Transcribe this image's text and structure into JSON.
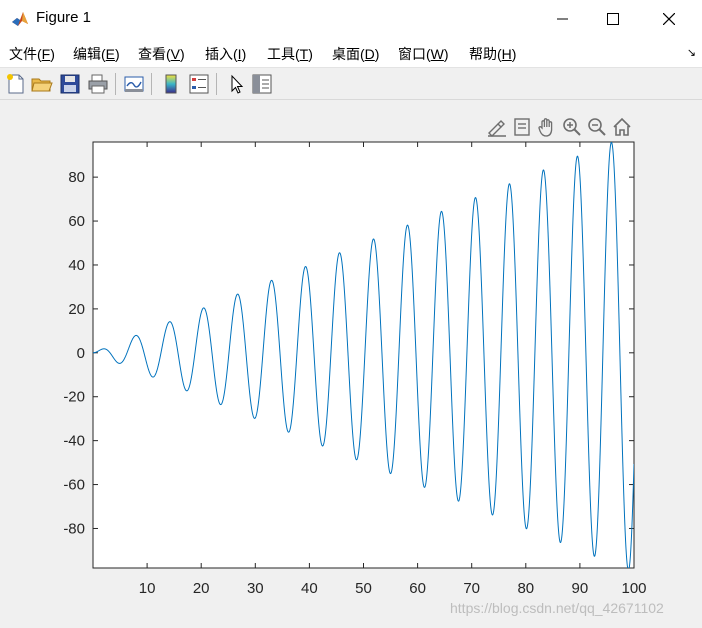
{
  "window": {
    "title": "Figure 1"
  },
  "menu": {
    "items": [
      {
        "label": "文件(",
        "key": "F",
        "tail": ")"
      },
      {
        "label": "编辑(",
        "key": "E",
        "tail": ")"
      },
      {
        "label": "查看(",
        "key": "V",
        "tail": ")"
      },
      {
        "label": "插入(",
        "key": "I",
        "tail": ")"
      },
      {
        "label": "工具(",
        "key": "T",
        "tail": ")"
      },
      {
        "label": "桌面(",
        "key": "D",
        "tail": ")"
      },
      {
        "label": "窗口(",
        "key": "W",
        "tail": ")"
      },
      {
        "label": "帮助(",
        "key": "H",
        "tail": ")"
      }
    ],
    "overflow_glyph": "↘"
  },
  "watermark": "https://blog.csdn.net/qq_42671102",
  "colors": {
    "line": "#0072bd",
    "axes_bg": "#ffffff",
    "figure_bg": "#f0f0f0"
  },
  "chart_data": {
    "type": "line",
    "title": "",
    "xlabel": "",
    "ylabel": "",
    "xlim": [
      0,
      100
    ],
    "ylim": [
      -98,
      96
    ],
    "xticks": [
      10,
      20,
      30,
      40,
      50,
      60,
      70,
      80,
      90,
      100
    ],
    "yticks": [
      80,
      60,
      40,
      20,
      0,
      -20,
      -40,
      -60,
      -80
    ],
    "function": "y = x * sin(x)",
    "grid": false,
    "series": [
      {
        "color": "#0072bd"
      }
    ]
  }
}
